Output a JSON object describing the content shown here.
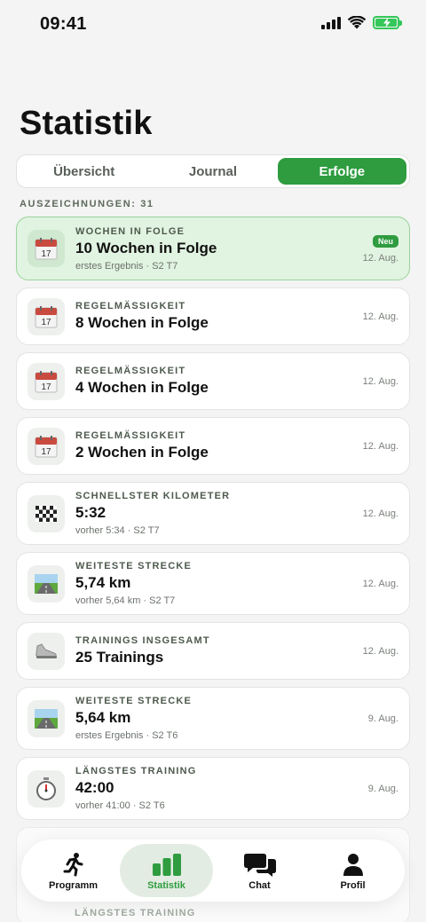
{
  "status": {
    "time": "09:41"
  },
  "page": {
    "title": "Statistik"
  },
  "tabs": [
    {
      "label": "Übersicht",
      "active": false
    },
    {
      "label": "Journal",
      "active": false
    },
    {
      "label": "Erfolge",
      "active": true
    }
  ],
  "section": {
    "header": "AUSZEICHNUNGEN: 31"
  },
  "achievements": [
    {
      "icon": "calendar-icon",
      "category": "WOCHEN IN FOLGE",
      "title": "10 Wochen in Folge",
      "subtitle": "erstes Ergebnis · S2 T7",
      "date": "12. Aug.",
      "badge": "Neu",
      "highlight": true
    },
    {
      "icon": "calendar-icon",
      "category": "REGELMÄSSIGKEIT",
      "title": "8 Wochen in Folge",
      "subtitle": "",
      "date": "12. Aug."
    },
    {
      "icon": "calendar-icon",
      "category": "REGELMÄSSIGKEIT",
      "title": "4 Wochen in Folge",
      "subtitle": "",
      "date": "12. Aug."
    },
    {
      "icon": "calendar-icon",
      "category": "REGELMÄSSIGKEIT",
      "title": "2 Wochen in Folge",
      "subtitle": "",
      "date": "12. Aug."
    },
    {
      "icon": "checkered-flag-icon",
      "category": "SCHNELLSTER KILOMETER",
      "title": "5:32",
      "subtitle": "vorher 5:34 · S2 T7",
      "date": "12. Aug."
    },
    {
      "icon": "road-icon",
      "category": "WEITESTE STRECKE",
      "title": "5,74 km",
      "subtitle": "vorher 5,64 km · S2 T7",
      "date": "12. Aug."
    },
    {
      "icon": "shoe-icon",
      "category": "TRAININGS INSGESAMT",
      "title": "25 Trainings",
      "subtitle": "",
      "date": "12. Aug."
    },
    {
      "icon": "road-icon",
      "category": "WEITESTE STRECKE",
      "title": "5,64 km",
      "subtitle": "erstes Ergebnis · S2 T6",
      "date": "9. Aug."
    },
    {
      "icon": "stopwatch-icon",
      "category": "LÄNGSTES TRAINING",
      "title": "42:00",
      "subtitle": "vorher 41:00 · S2 T6",
      "date": "9. Aug."
    }
  ],
  "ghost": {
    "category": "LÄNGSTES TRAINING"
  },
  "nav": [
    {
      "icon": "runner-icon",
      "label": "Programm",
      "active": false
    },
    {
      "icon": "bar-chart-icon",
      "label": "Statistik",
      "active": true
    },
    {
      "icon": "chat-icon",
      "label": "Chat",
      "active": false
    },
    {
      "icon": "profile-icon",
      "label": "Profil",
      "active": false
    }
  ],
  "colors": {
    "accent": "#2e9c3f",
    "highlight_bg": "#e1f3e1",
    "background": "#f3f4f3"
  }
}
